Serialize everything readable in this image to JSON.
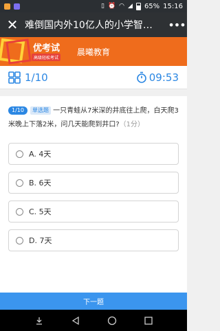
{
  "status": {
    "battery": "65%",
    "time": "15:16"
  },
  "titlebar": {
    "title": "难倒国内外10亿人的小学智…"
  },
  "banner": {
    "logo_title": "优考试",
    "logo_sub": "高级轻松考试",
    "org_name": "晨曦教育"
  },
  "qbar": {
    "count": "1/10",
    "timer": "09:53"
  },
  "question": {
    "number": "1/10",
    "type": "单选题",
    "text": "一只青蛙从7米深的井底往上爬，白天爬3米晚上下落2米，问几天能爬到井口?",
    "score": "（1分）"
  },
  "options": [
    {
      "label": "A. 4天"
    },
    {
      "label": "B. 6天"
    },
    {
      "label": "C. 5天"
    },
    {
      "label": "D. 7天"
    }
  ],
  "next_button": "下一题",
  "colors": {
    "accent": "#2b87e3",
    "banner": "#ef6c1c",
    "titlebar": "#2e3134"
  }
}
